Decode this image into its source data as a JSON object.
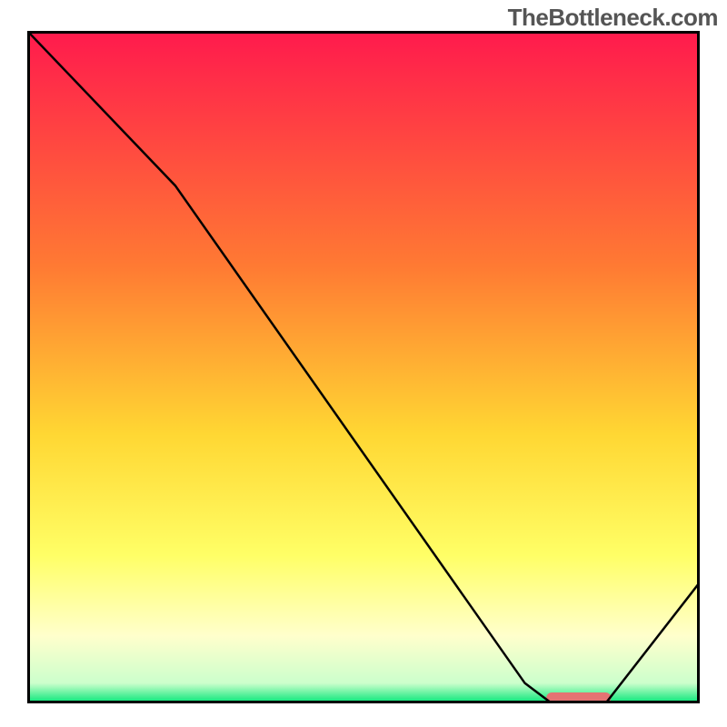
{
  "watermark": "TheBottleneck.com",
  "chart_data": {
    "type": "line",
    "title": "",
    "xlabel": "",
    "ylabel": "",
    "xlim": [
      0,
      100
    ],
    "ylim": [
      0,
      100
    ],
    "grid": false,
    "legend": false,
    "gradient_stops": [
      {
        "offset": 0.0,
        "color": "#ff1a4d"
      },
      {
        "offset": 0.35,
        "color": "#ff7a33"
      },
      {
        "offset": 0.6,
        "color": "#ffd733"
      },
      {
        "offset": 0.78,
        "color": "#ffff66"
      },
      {
        "offset": 0.9,
        "color": "#ffffcc"
      },
      {
        "offset": 0.97,
        "color": "#ccffcc"
      },
      {
        "offset": 1.0,
        "color": "#00e676"
      }
    ],
    "curve": {
      "x": [
        0,
        22,
        74,
        78,
        86,
        100
      ],
      "y": [
        100,
        77,
        3,
        0,
        0,
        18
      ]
    },
    "marker": {
      "x_start": 78,
      "x_end": 86,
      "y": 0,
      "color": "#e57373",
      "width": 3
    }
  }
}
